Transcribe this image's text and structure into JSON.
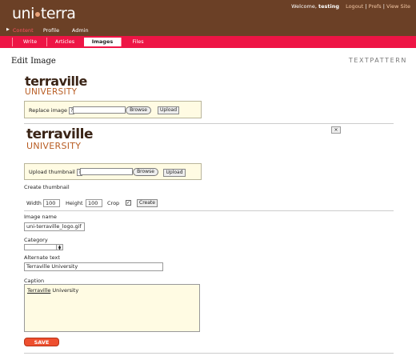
{
  "header": {
    "logo_left": "uni",
    "logo_right": "terra",
    "welcome_prefix": "Welcome, ",
    "username": "testing",
    "links": [
      "Logout",
      "Prefs",
      "View Site"
    ],
    "separator": " | "
  },
  "primary_tabs": [
    {
      "label": "Content",
      "active": true
    },
    {
      "label": "Profile",
      "active": false
    },
    {
      "label": "Admin",
      "active": false
    }
  ],
  "secondary_tabs": [
    {
      "label": "Write",
      "active": false
    },
    {
      "label": "Articles",
      "active": false
    },
    {
      "label": "Images",
      "active": true
    },
    {
      "label": "Files",
      "active": false
    }
  ],
  "page": {
    "title": "Edit Image",
    "brand": "TEXTPATTERN"
  },
  "image_logo": {
    "line1": "terraville",
    "line2": "UNIVERSITY"
  },
  "replace": {
    "label": "Replace image",
    "help": "?",
    "browse": "Browse",
    "upload": "Upload"
  },
  "thumbnail": {
    "logo_line1": "terraville",
    "logo_line2": "UNIVERSITY",
    "close": "×",
    "upload_label": "Upload thumbnail",
    "help": "?",
    "browse": "Browse",
    "upload": "Upload"
  },
  "create_thumbnail": {
    "heading": "Create thumbnail",
    "width_label": "Width",
    "width_value": "100",
    "height_label": "Height",
    "height_value": "100",
    "crop_label": "Crop",
    "crop_checked": true,
    "create_button": "Create"
  },
  "form": {
    "image_name_label": "Image name",
    "image_name_value": "uni-terraville_logo.gif",
    "category_label": "Category",
    "category_value": "",
    "alt_label": "Alternate text",
    "alt_value": "Terraville University",
    "caption_label": "Caption",
    "caption_word1": "Terraville",
    "caption_word2": " University",
    "save": "SAVE"
  },
  "colors": {
    "header_bg": "#6b4026",
    "subnav_bg": "#ee1545",
    "active_tab": "#ff4f5f",
    "save_bg": "#ee4f2f",
    "box_bg": "#fffbe3"
  }
}
